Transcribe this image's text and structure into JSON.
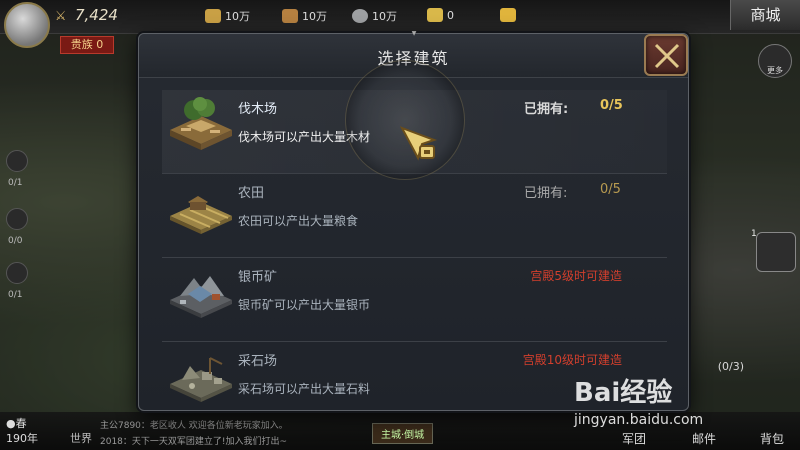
{
  "top_bar": {
    "power_value": "7,424",
    "resources": [
      {
        "icon": "coin-bag-icon",
        "value": "10万",
        "color": "#c9a045"
      },
      {
        "icon": "log-icon",
        "value": "10万",
        "color": "#b58040"
      },
      {
        "icon": "silver-icon",
        "value": "10万",
        "color": "#9ea0a2"
      },
      {
        "icon": "grain-icon",
        "value": "0",
        "color": "#d9b84a"
      },
      {
        "icon": "gold-icon",
        "value": "",
        "color": "#e0b43c"
      }
    ],
    "shop_label": "商城",
    "vip_label": "贵族 0",
    "more_label": "更多"
  },
  "left_side": {
    "counters": [
      "0/1",
      "0/0",
      "0/1"
    ]
  },
  "right_side": {
    "badge_count": "1",
    "count_text": "(0/3)"
  },
  "bottom_bar": {
    "season": "春",
    "year": "190年",
    "world_label": "世界",
    "chat_lines": [
      "主公7890：老区收人 欢迎各位新老玩家加入。",
      "2018：天下一天双军团建立了!加入我们打出~"
    ],
    "lord_button": "主城·倒城",
    "menu": [
      "军团",
      "邮件",
      "背包"
    ]
  },
  "modal": {
    "title": "选择建筑",
    "owned_label": "已拥有:",
    "buildings": [
      {
        "name": "伐木场",
        "desc": "伐木场可以产出大量木材",
        "owned": "0/5",
        "requirement": ""
      },
      {
        "name": "农田",
        "desc": "农田可以产出大量粮食",
        "owned": "0/5",
        "requirement": ""
      },
      {
        "name": "银币矿",
        "desc": "银币矿可以产出大量银币",
        "owned": "",
        "requirement": "宫殿5级时可建造"
      },
      {
        "name": "采石场",
        "desc": "采石场可以产出大量石料",
        "owned": "",
        "requirement": "宫殿10级时可建造"
      }
    ]
  },
  "watermark": {
    "logo": "Bai经验",
    "url": "jingyan.baidu.com"
  },
  "colors": {
    "owned_value": "#e8c55b",
    "requirement": "#d23f2d",
    "modal_bg": "#23272d"
  }
}
